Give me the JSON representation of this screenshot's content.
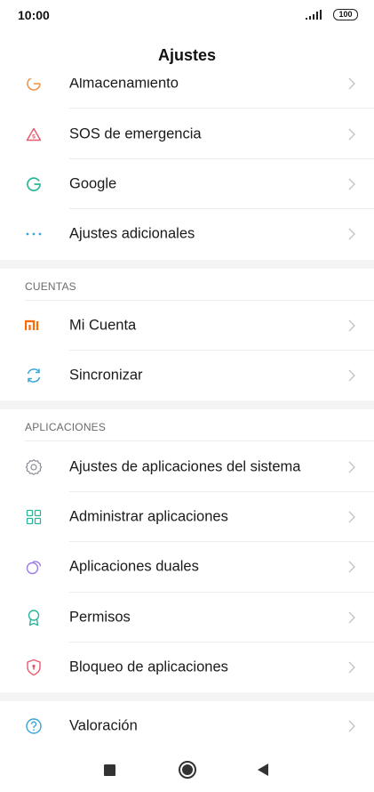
{
  "status_bar": {
    "time": "10:00",
    "battery": "100"
  },
  "header": {
    "title": "Ajustes"
  },
  "groups": {
    "top": [
      {
        "label": "Almacenamiento",
        "icon": "storage-icon"
      },
      {
        "label": "SOS de emergencia",
        "icon": "sos-icon"
      },
      {
        "label": "Google",
        "icon": "google-icon"
      },
      {
        "label": "Ajustes adicionales",
        "icon": "more-icon"
      }
    ],
    "cuentas_header": "CUENTAS",
    "cuentas": [
      {
        "label": "Mi Cuenta",
        "icon": "mi-icon"
      },
      {
        "label": "Sincronizar",
        "icon": "sync-icon"
      }
    ],
    "aplicaciones_header": "APLICACIONES",
    "aplicaciones": [
      {
        "label": "Ajustes de aplicaciones del sistema",
        "icon": "gear-icon"
      },
      {
        "label": "Administrar aplicaciones",
        "icon": "apps-grid-icon"
      },
      {
        "label": "Aplicaciones duales",
        "icon": "dual-apps-icon"
      },
      {
        "label": "Permisos",
        "icon": "permissions-icon"
      },
      {
        "label": "Bloqueo de aplicaciones",
        "icon": "app-lock-icon"
      }
    ],
    "bottom": [
      {
        "label": "Valoración",
        "icon": "help-icon"
      }
    ]
  },
  "colors": {
    "orange": "#f29447",
    "red_pink": "#e8576b",
    "teal": "#2bb59a",
    "blue": "#3aa6d6",
    "purple": "#9b7be8",
    "mi_orange": "#ff6900"
  }
}
